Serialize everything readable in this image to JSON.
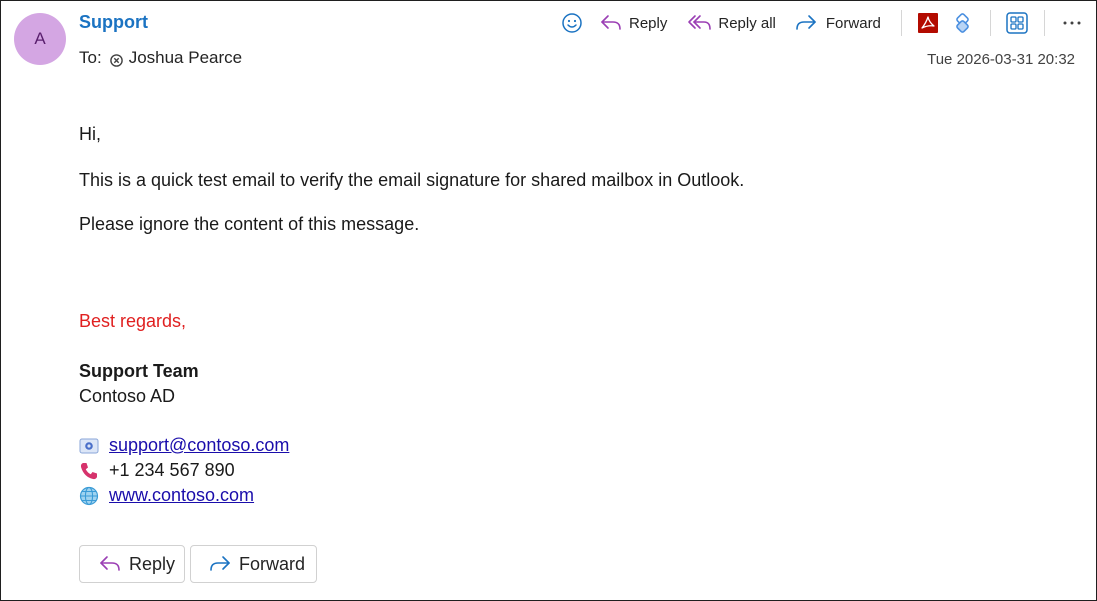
{
  "header": {
    "avatar_initial": "A",
    "sender": "Support",
    "to_label": "To:",
    "recipient": "Joshua Pearce",
    "timestamp": "Tue 2026-03-31 20:32"
  },
  "toolbar": {
    "reply_label": "Reply",
    "reply_all_label": "Reply all",
    "forward_label": "Forward",
    "icons": [
      "emoji-icon",
      "reply-icon",
      "reply-all-icon",
      "forward-icon",
      "pdf-icon",
      "loop-icon",
      "apps-icon",
      "more-icon"
    ]
  },
  "body": {
    "greeting": "Hi,",
    "line1": "This is a quick test email to verify the email signature for shared mailbox in Outlook.",
    "line2": "Please ignore the content of this message."
  },
  "signature": {
    "closing": "Best regards,",
    "name": "Support Team",
    "company": "Contoso AD",
    "email": "support@contoso.com",
    "phone": "+1 234 567 890",
    "website": "www.contoso.com"
  },
  "actions": {
    "reply_label": "Reply",
    "forward_label": "Forward"
  },
  "colors": {
    "sender": "#1b73c2",
    "closing": "#e02020",
    "link": "#1a0dab",
    "avatar_bg": "#d4a6e3",
    "reply_icon": "#9b3fb4",
    "forward_icon": "#1b73c2"
  }
}
